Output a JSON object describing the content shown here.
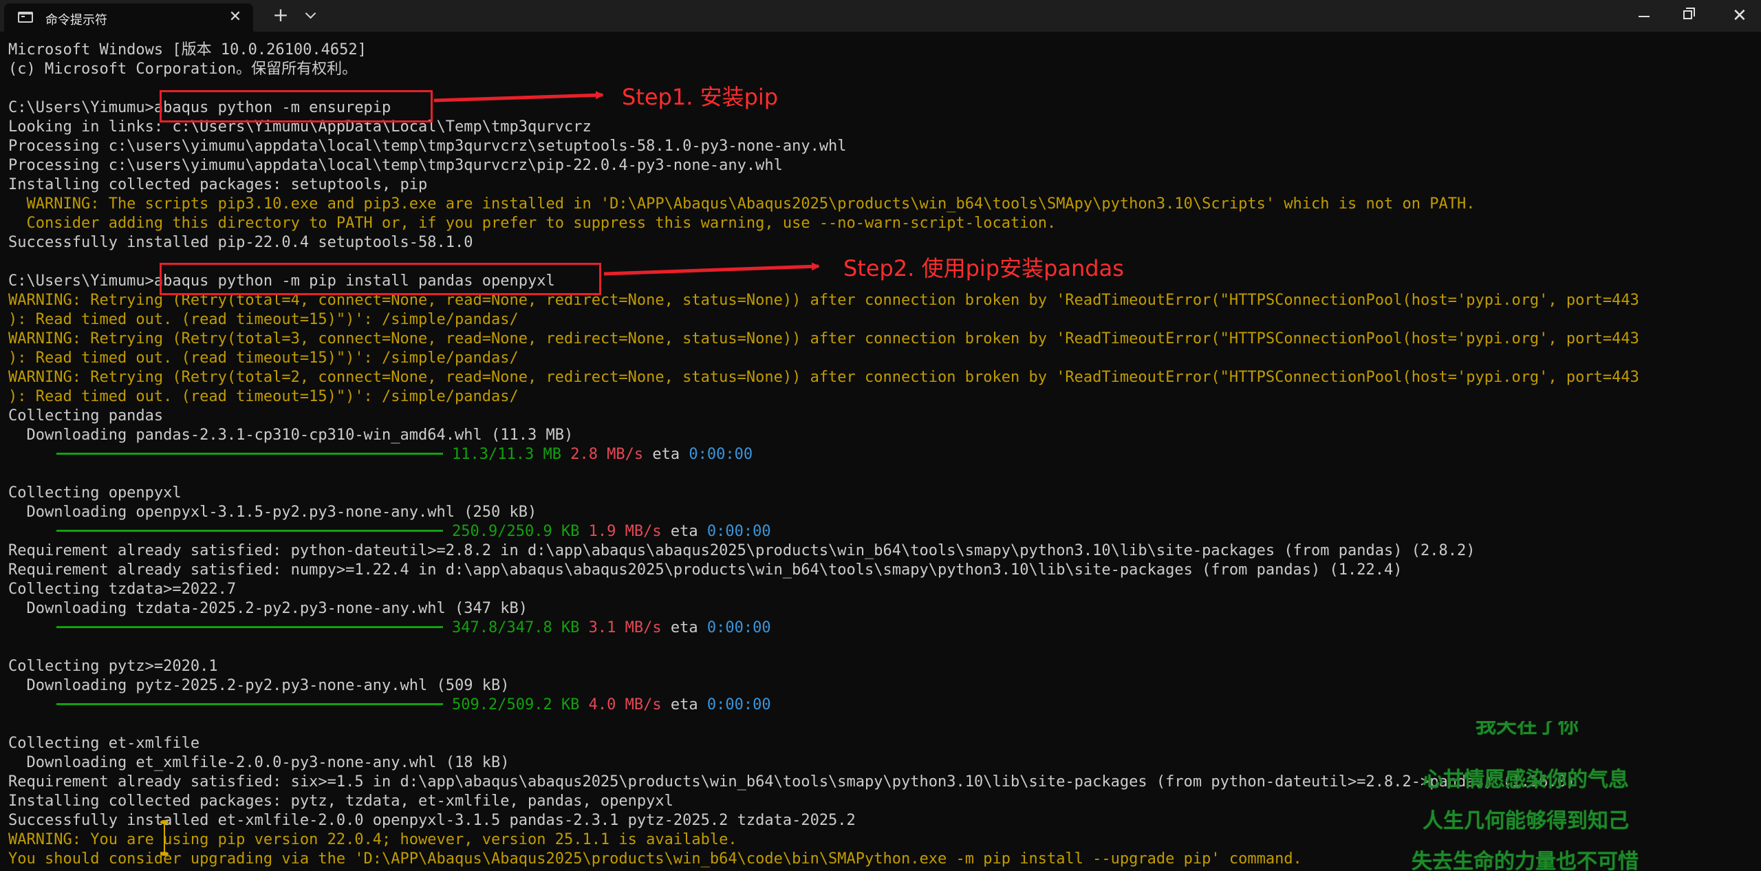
{
  "window": {
    "tab_title": "命令提示符",
    "close_tab_glyph": "✕",
    "new_tab_glyph": "+",
    "close_window_glyph": "✕"
  },
  "terminal": {
    "lines": [
      {
        "segments": [
          {
            "t": "Microsoft Windows [版本 10.0.26100.4652]",
            "c": "default"
          }
        ]
      },
      {
        "segments": [
          {
            "t": "(c) Microsoft Corporation。保留所有权利。",
            "c": "default"
          }
        ]
      },
      {
        "segments": [
          {
            "t": "",
            "c": "default"
          }
        ]
      },
      {
        "segments": [
          {
            "t": "C:\\Users\\Yimumu>abaqus python -m ensurepip",
            "c": "default"
          }
        ]
      },
      {
        "segments": [
          {
            "t": "Looking in links: c:\\Users\\Yimumu\\AppData\\Local\\Temp\\tmp3qurvcrz",
            "c": "default"
          }
        ]
      },
      {
        "segments": [
          {
            "t": "Processing c:\\users\\yimumu\\appdata\\local\\temp\\tmp3qurvcrz\\setuptools-58.1.0-py3-none-any.whl",
            "c": "default"
          }
        ]
      },
      {
        "segments": [
          {
            "t": "Processing c:\\users\\yimumu\\appdata\\local\\temp\\tmp3qurvcrz\\pip-22.0.4-py3-none-any.whl",
            "c": "default"
          }
        ]
      },
      {
        "segments": [
          {
            "t": "Installing collected packages: setuptools, pip",
            "c": "default"
          }
        ]
      },
      {
        "segments": [
          {
            "t": "  WARNING: The scripts pip3.10.exe and pip3.exe are installed in 'D:\\APP\\Abaqus\\Abaqus2025\\products\\win_b64\\tools\\SMApy\\python3.10\\Scripts' which is not on PATH.",
            "c": "warn"
          }
        ]
      },
      {
        "segments": [
          {
            "t": "  Consider adding this directory to PATH or, if you prefer to suppress this warning, use --no-warn-script-location.",
            "c": "warn"
          }
        ]
      },
      {
        "segments": [
          {
            "t": "Successfully installed pip-22.0.4 setuptools-58.1.0",
            "c": "default"
          }
        ]
      },
      {
        "segments": [
          {
            "t": "",
            "c": "default"
          }
        ]
      },
      {
        "segments": [
          {
            "t": "C:\\Users\\Yimumu>abaqus python -m pip install pandas openpyxl",
            "c": "default"
          }
        ]
      },
      {
        "segments": [
          {
            "t": "WARNING: Retrying (Retry(total=4, connect=None, read=None, redirect=None, status=None)) after connection broken by 'ReadTimeoutError(\"HTTPSConnectionPool(host='pypi.org', port=443",
            "c": "warn"
          }
        ]
      },
      {
        "segments": [
          {
            "t": "): Read timed out. (read timeout=15)\")': /simple/pandas/",
            "c": "warn"
          }
        ]
      },
      {
        "segments": [
          {
            "t": "WARNING: Retrying (Retry(total=3, connect=None, read=None, redirect=None, status=None)) after connection broken by 'ReadTimeoutError(\"HTTPSConnectionPool(host='pypi.org', port=443",
            "c": "warn"
          }
        ]
      },
      {
        "segments": [
          {
            "t": "): Read timed out. (read timeout=15)\")': /simple/pandas/",
            "c": "warn"
          }
        ]
      },
      {
        "segments": [
          {
            "t": "WARNING: Retrying (Retry(total=2, connect=None, read=None, redirect=None, status=None)) after connection broken by 'ReadTimeoutError(\"HTTPSConnectionPool(host='pypi.org', port=443",
            "c": "warn"
          }
        ]
      },
      {
        "segments": [
          {
            "t": "): Read timed out. (read timeout=15)\")': /simple/pandas/",
            "c": "warn"
          }
        ]
      },
      {
        "segments": [
          {
            "t": "Collecting pandas",
            "c": "default"
          }
        ]
      },
      {
        "segments": [
          {
            "t": "  Downloading pandas-2.3.1-cp310-cp310-win_amd64.whl (11.3 MB)",
            "c": "default"
          }
        ]
      },
      {
        "bar": true,
        "segments": [
          {
            "t": "11.3/11.3 MB",
            "c": "green"
          },
          {
            "t": " 2.8 MB/s",
            "c": "red"
          },
          {
            "t": " eta ",
            "c": "default"
          },
          {
            "t": "0:00:00",
            "c": "cyan"
          }
        ]
      },
      {
        "segments": [
          {
            "t": "",
            "c": "default"
          }
        ]
      },
      {
        "segments": [
          {
            "t": "Collecting openpyxl",
            "c": "default"
          }
        ]
      },
      {
        "segments": [
          {
            "t": "  Downloading openpyxl-3.1.5-py2.py3-none-any.whl (250 kB)",
            "c": "default"
          }
        ]
      },
      {
        "bar": true,
        "segments": [
          {
            "t": "250.9/250.9 KB",
            "c": "green"
          },
          {
            "t": " 1.9 MB/s",
            "c": "red"
          },
          {
            "t": " eta ",
            "c": "default"
          },
          {
            "t": "0:00:00",
            "c": "cyan"
          }
        ]
      },
      {
        "segments": [
          {
            "t": "Requirement already satisfied: python-dateutil>=2.8.2 in d:\\app\\abaqus\\abaqus2025\\products\\win_b64\\tools\\smapy\\python3.10\\lib\\site-packages (from pandas) (2.8.2)",
            "c": "default"
          }
        ]
      },
      {
        "segments": [
          {
            "t": "Requirement already satisfied: numpy>=1.22.4 in d:\\app\\abaqus\\abaqus2025\\products\\win_b64\\tools\\smapy\\python3.10\\lib\\site-packages (from pandas) (1.22.4)",
            "c": "default"
          }
        ]
      },
      {
        "segments": [
          {
            "t": "Collecting tzdata>=2022.7",
            "c": "default"
          }
        ]
      },
      {
        "segments": [
          {
            "t": "  Downloading tzdata-2025.2-py2.py3-none-any.whl (347 kB)",
            "c": "default"
          }
        ]
      },
      {
        "bar": true,
        "segments": [
          {
            "t": "347.8/347.8 KB",
            "c": "green"
          },
          {
            "t": " 3.1 MB/s",
            "c": "red"
          },
          {
            "t": " eta ",
            "c": "default"
          },
          {
            "t": "0:00:00",
            "c": "cyan"
          }
        ]
      },
      {
        "segments": [
          {
            "t": "",
            "c": "default"
          }
        ]
      },
      {
        "segments": [
          {
            "t": "Collecting pytz>=2020.1",
            "c": "default"
          }
        ]
      },
      {
        "segments": [
          {
            "t": "  Downloading pytz-2025.2-py2.py3-none-any.whl (509 kB)",
            "c": "default"
          }
        ]
      },
      {
        "bar": true,
        "segments": [
          {
            "t": "509.2/509.2 KB",
            "c": "green"
          },
          {
            "t": " 4.0 MB/s",
            "c": "red"
          },
          {
            "t": " eta ",
            "c": "default"
          },
          {
            "t": "0:00:00",
            "c": "cyan"
          }
        ]
      },
      {
        "segments": [
          {
            "t": "",
            "c": "default"
          }
        ]
      },
      {
        "segments": [
          {
            "t": "Collecting et-xmlfile",
            "c": "default"
          }
        ]
      },
      {
        "segments": [
          {
            "t": "  Downloading et_xmlfile-2.0.0-py3-none-any.whl (18 kB)",
            "c": "default"
          }
        ]
      },
      {
        "segments": [
          {
            "t": "Requirement already satisfied: six>=1.5 in d:\\app\\abaqus\\abaqus2025\\products\\win_b64\\tools\\smapy\\python3.10\\lib\\site-packages (from python-dateutil>=2.8.2->pandas) (1.16.0)",
            "c": "default"
          }
        ]
      },
      {
        "segments": [
          {
            "t": "Installing collected packages: pytz, tzdata, et-xmlfile, pandas, openpyxl",
            "c": "default"
          }
        ]
      },
      {
        "segments": [
          {
            "t": "Successfully installed et-xmlfile-2.0.0 openpyxl-3.1.5 pandas-2.3.1 pytz-2025.2 tzdata-2025.2",
            "c": "default"
          }
        ]
      },
      {
        "segments": [
          {
            "t": "WARNING: You are using pip version 22.0.4; however, version 25.1.1 is available.",
            "c": "warn"
          }
        ]
      },
      {
        "segments": [
          {
            "t": "You should consider upgrading via the 'D:\\APP\\Abaqus\\Abaqus2025\\products\\win_b64\\code\\bin\\SMAPython.exe -m pip install --upgrade pip' command.",
            "c": "warn"
          }
        ]
      },
      {
        "segments": [
          {
            "t": "",
            "c": "default"
          }
        ]
      },
      {
        "segments": [
          {
            "t": "C:\\Users\\Yimumu>",
            "c": "default"
          }
        ]
      }
    ]
  },
  "annotations": {
    "step1": "Step1. 安装pip",
    "step2": "Step2. 使用pip安装pandas"
  },
  "lyrics": {
    "partial": "我天在了你",
    "line1": "心甘情愿感染你的气息",
    "line2": "人生几何能够得到知己",
    "line3": "失去生命的力量也不可惜"
  },
  "colors": {
    "background": "#0c0c0c",
    "text": "#cccccc",
    "warning": "#c19c00",
    "progress_green": "#13a10e",
    "speed_red": "#e74856",
    "eta_cyan": "#3a96dd",
    "annotation_red": "#e8202a",
    "lyrics_green": "#1e8a2a"
  }
}
